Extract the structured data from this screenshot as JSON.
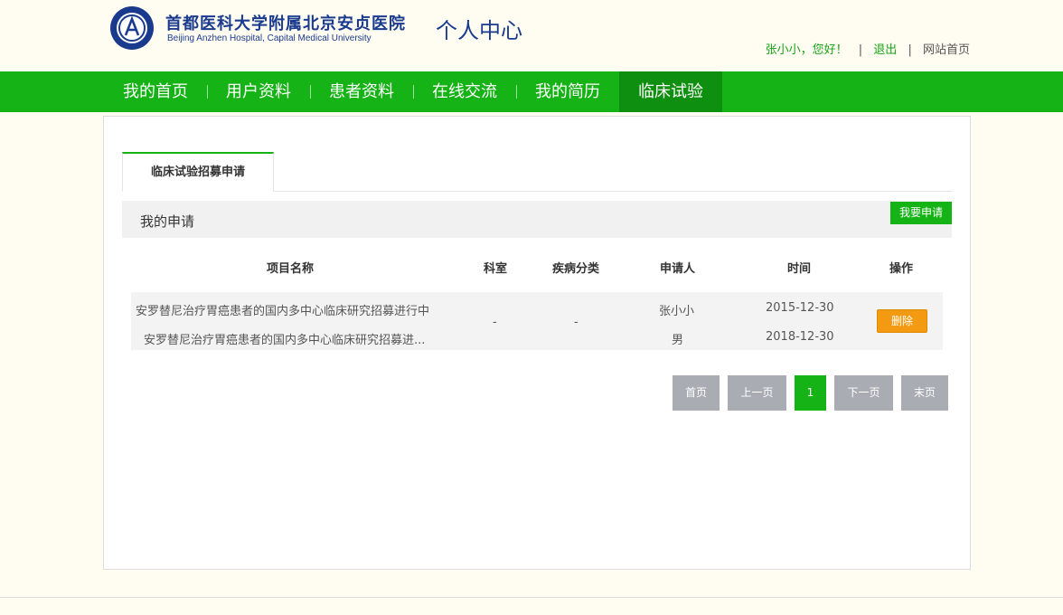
{
  "header": {
    "hospital_name_cn": "首都医科大学附属北京安贞医院",
    "hospital_name_en": "Beijing Anzhen Hospital, Capital Medical University",
    "section_title": "个人中心",
    "greeting": "张小小，您好！",
    "separator": "|",
    "logout_label": "退出",
    "site_home_label": "网站首页",
    "brand_color": "#1a3a8e"
  },
  "nav": {
    "items": [
      {
        "label": "我的首页"
      },
      {
        "label": "用户资料"
      },
      {
        "label": "患者资料"
      },
      {
        "label": "在线交流"
      },
      {
        "label": "我的简历"
      },
      {
        "label": "临床试验"
      }
    ],
    "active_index": 5,
    "color": "#16b316",
    "active_color": "#0f8f0f"
  },
  "main": {
    "tab_label": "临床试验招募申请",
    "section_title": "我的申请",
    "apply_button": "我要申请",
    "table": {
      "headers": [
        "项目名称",
        "科室",
        "疾病分类",
        "申请人",
        "时间",
        "操作"
      ],
      "rows": [
        {
          "project_line1": "安罗替尼治疗胃癌患者的国内多中心临床研究招募进行中",
          "project_line2": "安罗替尼治疗胃癌患者的国内多中心临床研究招募进...",
          "department": "-",
          "disease_category": "-",
          "applicant_name": "张小小",
          "applicant_gender": "男",
          "date_start": "2015-12-30",
          "date_end": "2018-12-30",
          "action_label": "删除",
          "action_color": "#f39a12"
        }
      ]
    },
    "pagination": {
      "first": "首页",
      "prev": "上一页",
      "current": "1",
      "next": "下一页",
      "last": "末页"
    }
  }
}
